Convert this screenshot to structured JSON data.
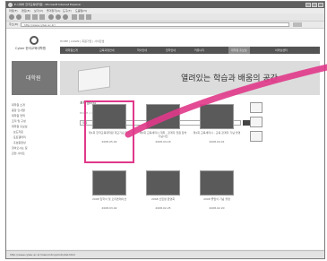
{
  "window": {
    "title": "E-사이버 한국교육대학원 - Microsoft Internet Explorer",
    "menu": [
      "파일(F)",
      "편집(E)",
      "보기(V)",
      "즐겨찾기(A)",
      "도구(T)",
      "도움말(H)"
    ],
    "address_label": "주소(D)",
    "address_value": "http://www.cyber.ac.kr/",
    "status_text": "http://www.cyber.ac.kr/main/intro/photo/list.html"
  },
  "site": {
    "logo_text": "Cyber 한국교육대학원",
    "top_links": "HOME | LOGIN | 회원가입 | 사이트맵",
    "nav": [
      "대학원소개",
      "교육과정안내",
      "학사안내",
      "입학안내",
      "커뮤니티",
      "대학원 홍보실",
      "이러닝센터"
    ],
    "side_banner": "대학원",
    "banner_text": "열려있는 학습과 배움의 공간"
  },
  "left_nav": [
    "대학원 소개",
    "총장 인사말",
    "대학원 연혁",
    "조직 및 구성",
    "대학원 홍보실",
    "· 보도자료",
    "· 포토갤러리",
    "· 홍보동영상",
    "찾아오시는 길",
    "관련 사이트"
  ],
  "main": {
    "title": "포토갤러리",
    "crumb": "HOME > 대학원소개 > 포토갤러리",
    "search_placeholder": "제목"
  },
  "gallery": [
    {
      "caption": "제1회 한국교육대학원 개교기념 행사",
      "meta": "2008.05.02"
    },
    {
      "caption": "제2회 교육세미나 개최 - 관계자 전원 참석 기념사진",
      "meta": "2008.04.18"
    },
    {
      "caption": "제1회 교육세미나 - 교육 관계자 기념 촬영",
      "meta": "2008.04.01"
    },
    {
      "caption": "2008 입학식 및 오리엔테이션",
      "meta": "2008.03.02"
    },
    {
      "caption": "2008 신입생 환영회",
      "meta": "2008.02.25"
    },
    {
      "caption": "2008 졸업식 기념 촬영",
      "meta": "2008.02.20"
    }
  ],
  "colors": {
    "highlight": "#e0388a",
    "nav_bg": "#545454"
  }
}
